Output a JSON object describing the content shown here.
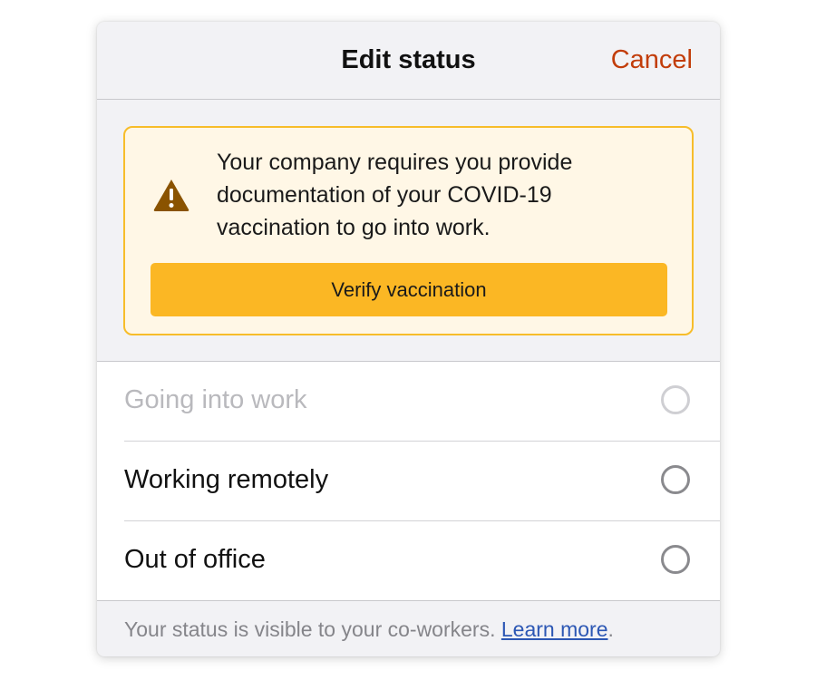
{
  "header": {
    "title": "Edit status",
    "cancel_label": "Cancel"
  },
  "banner": {
    "icon": "warning-triangle-icon",
    "message": "Your company requires you provide documentation of your COVID-19 vaccination to go into work.",
    "button_label": "Verify vaccination"
  },
  "options": [
    {
      "label": "Going into work",
      "disabled": true,
      "selected": false
    },
    {
      "label": "Working remotely",
      "disabled": false,
      "selected": false
    },
    {
      "label": "Out of office",
      "disabled": false,
      "selected": false
    }
  ],
  "footer": {
    "text": "Your status is visible to your co-workers. ",
    "link_label": "Learn more",
    "trailing": "."
  },
  "colors": {
    "accent": "#c23d0a",
    "button": "#fbb724",
    "banner_bg": "#fff7e6",
    "banner_border": "#f7bd2a",
    "warning_icon": "#8a5300",
    "link": "#2c57b4"
  }
}
